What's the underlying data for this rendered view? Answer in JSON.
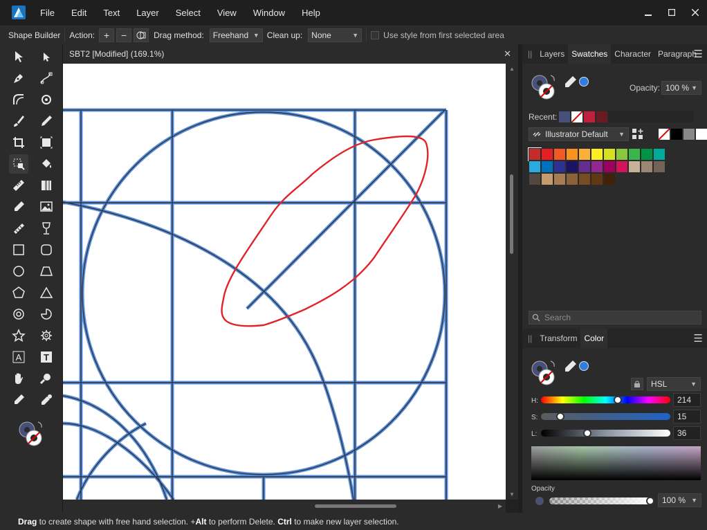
{
  "menubar": {
    "items": [
      "File",
      "Edit",
      "Text",
      "Layer",
      "Select",
      "View",
      "Window",
      "Help"
    ]
  },
  "context_toolbar": {
    "tool_name": "Shape Builder",
    "action_label": "Action:",
    "drag_method_label": "Drag method:",
    "drag_method_value": "Freehand",
    "clean_up_label": "Clean up:",
    "clean_up_value": "None",
    "use_style_label": "Use style from first selected area"
  },
  "document": {
    "title": "SBT2 [Modified] (169.1%)"
  },
  "swatches_panel": {
    "tabs": [
      "Layers",
      "Swatches",
      "Character",
      "Paragraph"
    ],
    "active_tab": "Swatches",
    "opacity_label": "Opacity:",
    "opacity_value": "100 %",
    "recent_label": "Recent:",
    "recent_colors": [
      "#46507a",
      "none",
      "#c0203c",
      "#6a1a22"
    ],
    "palette_name": "Illustrator Default",
    "search_placeholder": "Search",
    "palette_colors": [
      "#c42b2b",
      "#e61f25",
      "#f15a24",
      "#f7931e",
      "#fbb03b",
      "#fcee21",
      "#d9e021",
      "#8cc63f",
      "#39b54a",
      "#009245",
      "#00a99d",
      "#29abe2",
      "#0071bc",
      "#2e3192",
      "#1b1464",
      "#662d91",
      "#93278f",
      "#9e005d",
      "#d4145a",
      "#c7b299",
      "#998675",
      "#736357",
      "#534741",
      "#c69c6d",
      "#a67c52",
      "#8c6239",
      "#754c24",
      "#603813",
      "#42210b"
    ]
  },
  "color_panel": {
    "tabs": [
      "Transform",
      "Color"
    ],
    "active_tab": "Color",
    "mode_value": "HSL",
    "h_label": "H:",
    "h_value": "214",
    "s_label": "S:",
    "s_value": "15",
    "l_label": "L:",
    "l_value": "36",
    "opacity_label": "Opacity",
    "opacity_value": "100 %",
    "h_fraction": 0.594,
    "s_fraction": 0.15,
    "l_fraction": 0.36,
    "accent_color": "#2f7de1"
  },
  "statusbar": {
    "drag_key": "Drag",
    "text1": " to create shape with free hand selection. +",
    "alt_key": "Alt",
    "text2": " to perform Delete. ",
    "ctrl_key": "Ctrl",
    "text3": " to make new layer selection."
  }
}
